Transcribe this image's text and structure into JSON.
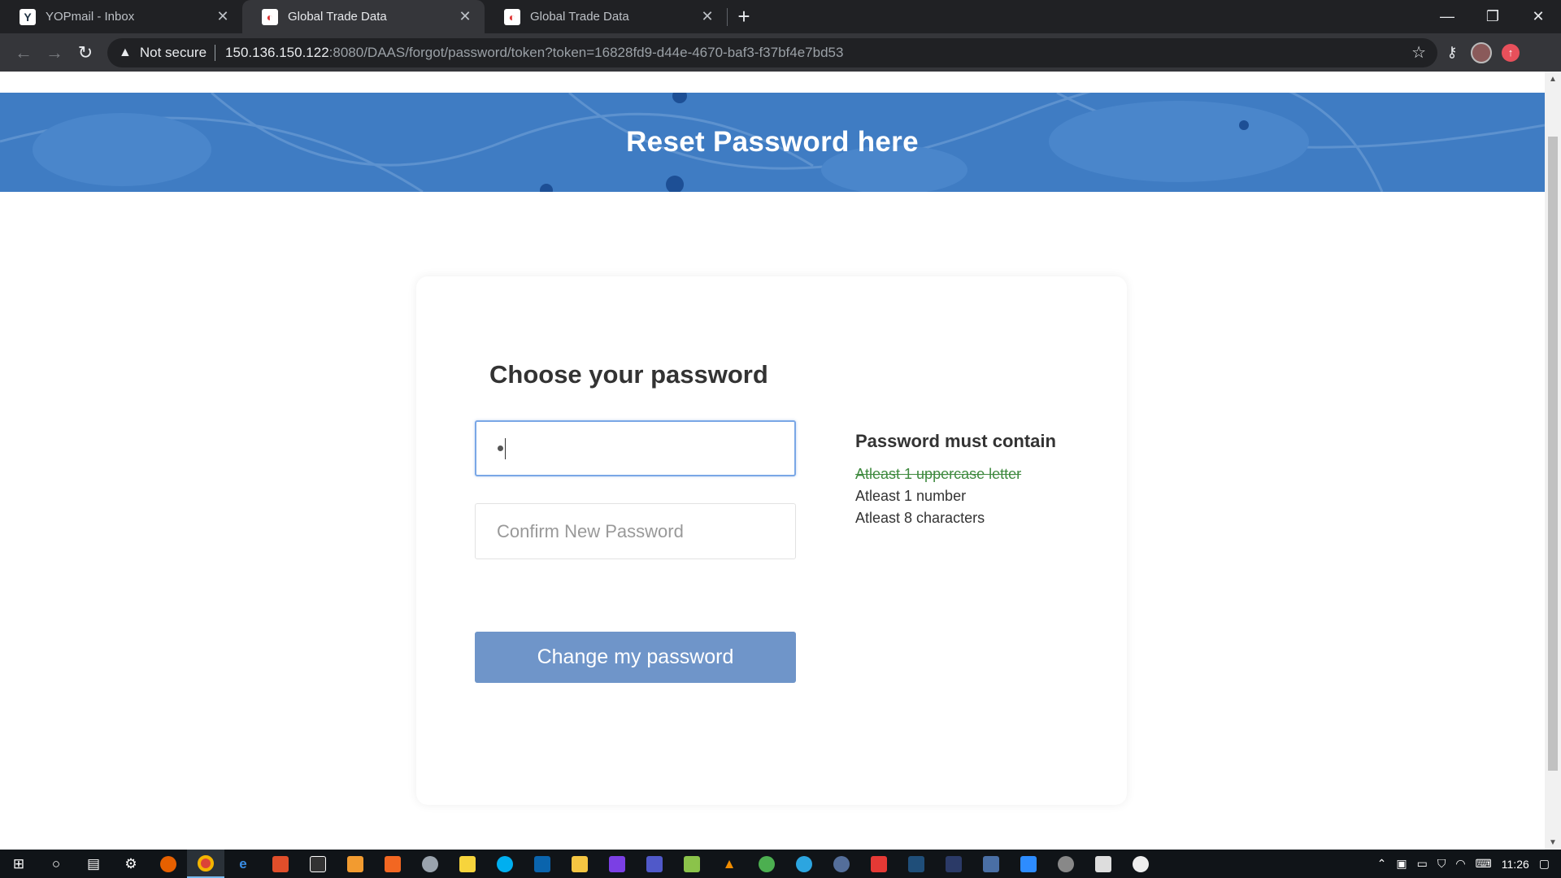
{
  "tabs": [
    {
      "title": "YOPmail - Inbox",
      "favicon": "yopmail-logo-icon"
    },
    {
      "title": "Global Trade Data",
      "favicon": "globe-logo-icon"
    },
    {
      "title": "Global Trade Data",
      "favicon": "globe-logo-icon"
    }
  ],
  "address": {
    "security": "Not secure",
    "host": "150.136.150.122",
    "path": ":8080/DAAS/forgot/password/token?token=16828fd9-d44e-4670-baf3-f37bf4e7bd53"
  },
  "hero": {
    "title": "Reset Password here"
  },
  "form": {
    "heading": "Choose your password",
    "confirm_placeholder": "Confirm New Password",
    "submit_label": "Change my password"
  },
  "rules": {
    "heading": "Password must contain",
    "items": [
      {
        "text": "Atleast 1 uppercase letter",
        "satisfied": true
      },
      {
        "text": "Atleast 1 number",
        "satisfied": false
      },
      {
        "text": "Atleast 8 characters",
        "satisfied": false
      }
    ]
  },
  "taskbar": {
    "clock": "11:26"
  },
  "colors": {
    "hero": "#3f7cc3",
    "button": "#6f95c9",
    "rule_done": "#3f8a3f"
  }
}
